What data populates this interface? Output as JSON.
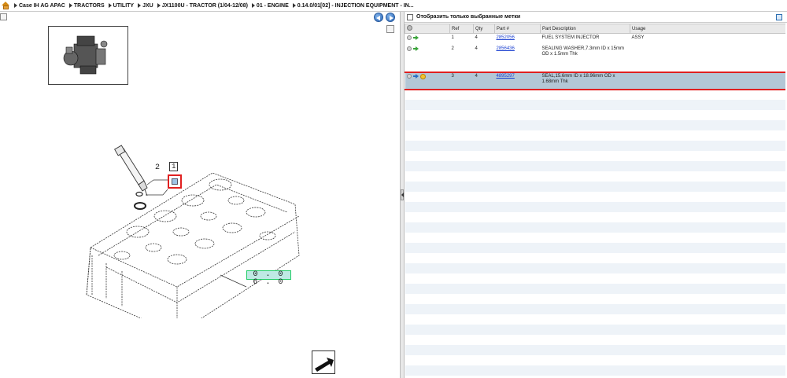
{
  "breadcrumb": [
    "Case IH AG APAC",
    "TRACTORS",
    "UTILITY",
    "JXU",
    "JX1100U - TRACTOR (1/04-12/08)",
    "01 - ENGINE",
    "0.14.0/01[02] - INJECTION EQUIPMENT - IN..."
  ],
  "diagram": {
    "callout_1": "1",
    "callout_2": "2",
    "ref_code": "0 . 0 6 . 0"
  },
  "parts_panel": {
    "filter_label": "Отобразить только выбранные метки",
    "columns": [
      "",
      "Ref",
      "Qty",
      "Part #",
      "Part Description",
      "Usage"
    ],
    "rows": [
      {
        "ref": "1",
        "qty": "4",
        "part": "2852056",
        "desc": "FUEL SYSTEM INJECTOR",
        "usage": "ASSY",
        "selected": false
      },
      {
        "ref": "2",
        "qty": "4",
        "part": "2856436",
        "desc": "SEALING WASHER,7.3mm ID x 15mm OD x 1.5mm Thk",
        "usage": "",
        "selected": false
      },
      {
        "ref": "3",
        "qty": "4",
        "part": "4895297",
        "desc": "SEAL,15.6mm ID x 18.96mm OD x 1.68mm Thk",
        "usage": "",
        "selected": true
      }
    ]
  },
  "colors": {
    "selected_row": "#b3c7d6",
    "highlight_outline": "#e02020",
    "link": "#1a3fd0",
    "ref_box": "#bfe9e4"
  },
  "icons": {
    "home": "home-icon",
    "nav_prev": "arrow-left-icon",
    "nav_next": "arrow-right-icon",
    "row_status": "circle-icon",
    "row_arrow": "arrow-right-icon",
    "row_favorite": "star-icon",
    "export": "export-arrow-icon"
  }
}
